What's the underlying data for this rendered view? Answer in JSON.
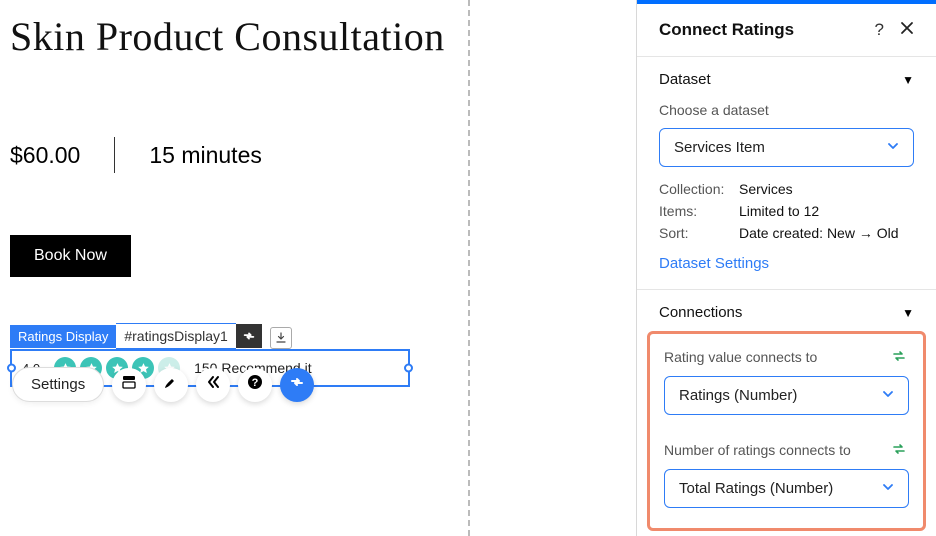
{
  "canvas": {
    "title": "Skin Product Consultation",
    "price": "$60.00",
    "duration": "15 minutes",
    "bookButton": "Book Now",
    "toolbar": {
      "settings": "Settings"
    },
    "elementTag": {
      "type": "Ratings Display",
      "name": "#ratingsDisplay1"
    },
    "ratings": {
      "value": "4.0",
      "count": "150",
      "label": "Recommend it"
    }
  },
  "panel": {
    "title": "Connect Ratings",
    "datasetSection": {
      "title": "Dataset",
      "chooseLabel": "Choose a dataset",
      "selected": "Services Item",
      "collectionLabel": "Collection:",
      "collectionValue": "Services",
      "itemsLabel": "Items:",
      "itemsValue": "Limited to 12",
      "sortLabel": "Sort:",
      "sortValue": "Date created: New → Old",
      "settingsLink": "Dataset Settings"
    },
    "connectionsSection": {
      "title": "Connections",
      "ratingValueLabel": "Rating value connects to",
      "ratingValueSelected": "Ratings (Number)",
      "numRatingsLabel": "Number of ratings connects to",
      "numRatingsSelected": "Total Ratings (Number)"
    }
  }
}
